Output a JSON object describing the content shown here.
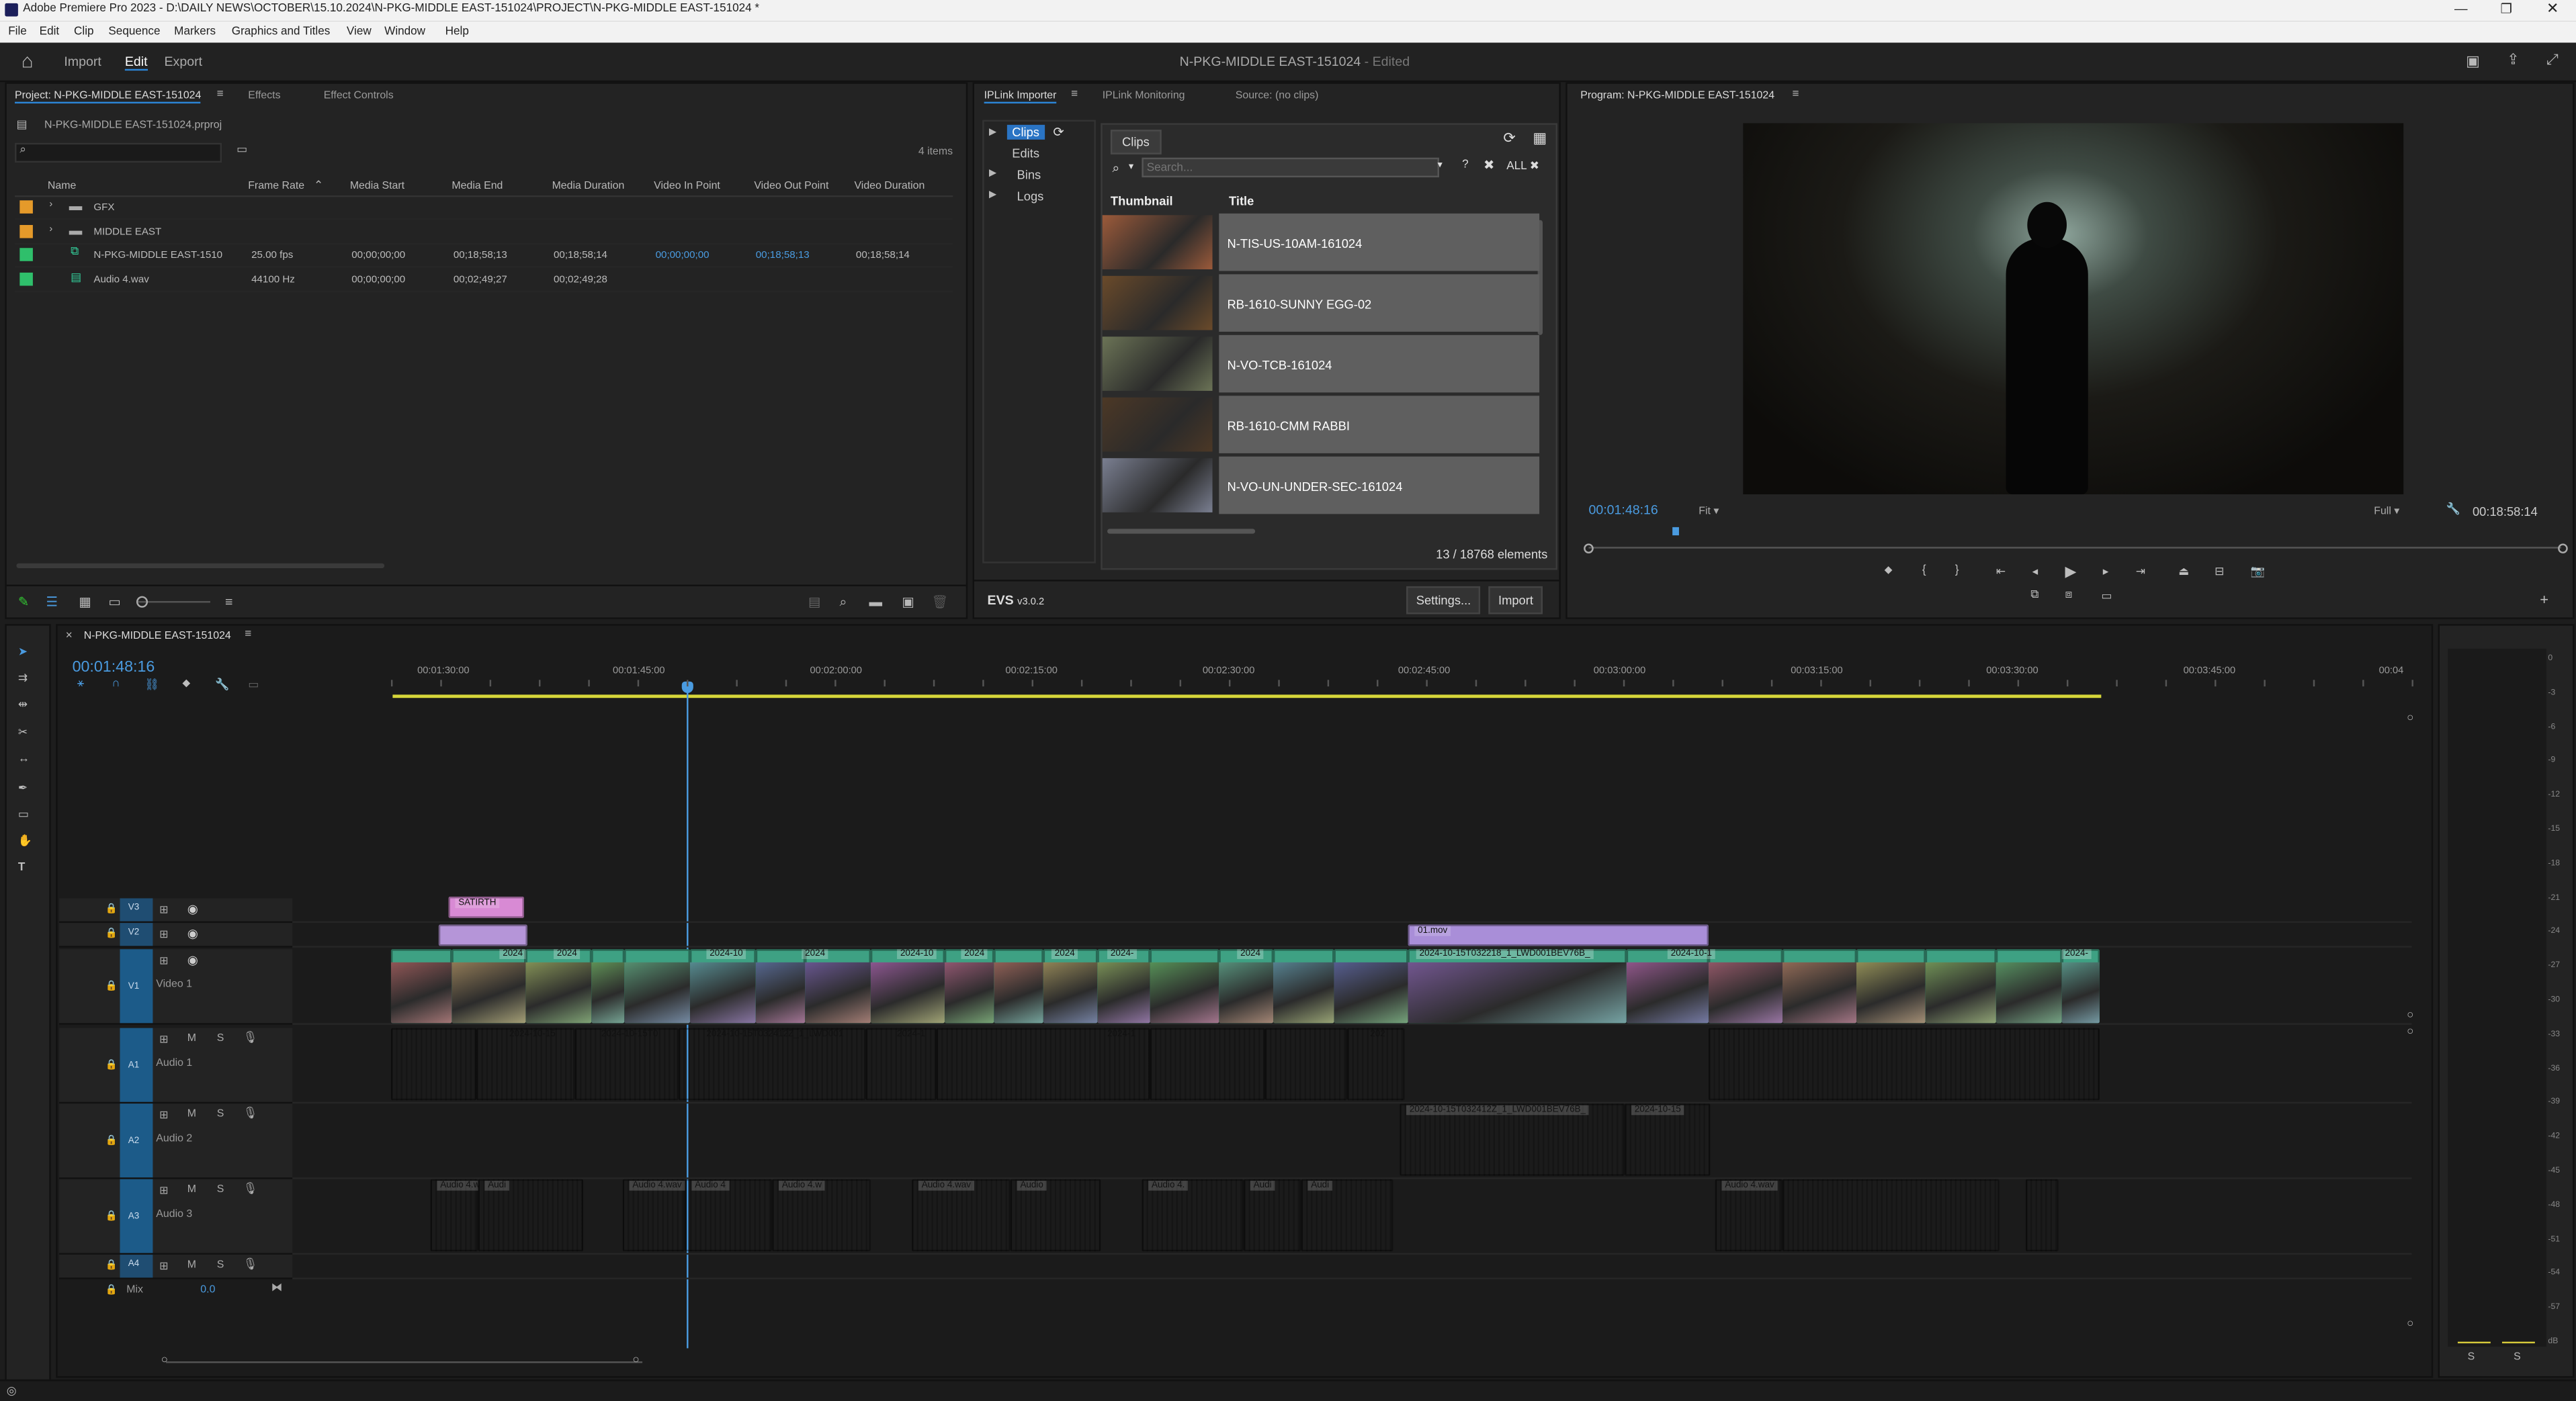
{
  "window": {
    "title": "Adobe Premiere Pro 2023 - D:\\DAILY NEWS\\OCTOBER\\15.10.2024\\N-PKG-MIDDLE EAST-151024\\PROJECT\\N-PKG-MIDDLE EAST-151024 *"
  },
  "menu": [
    "File",
    "Edit",
    "Clip",
    "Sequence",
    "Markers",
    "Graphics and Titles",
    "View",
    "Window",
    "Help"
  ],
  "header": {
    "nav": [
      "Import",
      "Edit",
      "Export"
    ],
    "doc_title": "N-PKG-MIDDLE EAST-151024",
    "doc_status": " - Edited"
  },
  "project_panel": {
    "tabs": [
      "Project: N-PKG-MIDDLE EAST-151024",
      "Effects",
      "Effect Controls"
    ],
    "file": "N-PKG-MIDDLE EAST-151024.prproj",
    "items_count": "4 items",
    "columns": [
      "Name",
      "Frame Rate",
      "Media Start",
      "Media End",
      "Media Duration",
      "Video In Point",
      "Video Out Point",
      "Video Duration"
    ],
    "rows": [
      {
        "name": "GFX",
        "fr": "",
        "ms": "",
        "me": "",
        "md": "",
        "vin": "",
        "vout": "",
        "vd": "",
        "color": "#e59a2a"
      },
      {
        "name": "MIDDLE EAST",
        "fr": "",
        "ms": "",
        "me": "",
        "md": "",
        "vin": "",
        "vout": "",
        "vd": "",
        "color": "#e59a2a"
      },
      {
        "name": "N-PKG-MIDDLE EAST-1510",
        "fr": "25.00 fps",
        "ms": "00;00;00;00",
        "me": "00;18;58;13",
        "md": "00;18;58;14",
        "vin": "00;00;00;00",
        "vout": "00;18;58;13",
        "vd": "00;18;58;14",
        "color": "#2fbf6b"
      },
      {
        "name": "Audio 4.wav",
        "fr": "44100 Hz",
        "ms": "00;00;00;00",
        "me": "00;02;49;27",
        "md": "00;02;49;28",
        "vin": "",
        "vout": "",
        "vd": "",
        "color": "#2fbf6b"
      }
    ]
  },
  "iplink": {
    "tabs": [
      "IPLink Importer",
      "IPLink Monitoring",
      "Source: (no clips)"
    ],
    "tree": [
      "Clips",
      "Edits",
      "Bins",
      "Logs"
    ],
    "clips_tab": "Clips",
    "search_placeholder": "Search...",
    "search_help": "?",
    "all_label": "ALL",
    "table_headers": [
      "Thumbnail",
      "Title"
    ],
    "clips": [
      "N-TIS-US-10AM-161024",
      "RB-1610-SUNNY EGG-02",
      "N-VO-TCB-161024",
      "RB-1610-CMM RABBI",
      "N-VO-UN-UNDER-SEC-161024"
    ],
    "count": "13 / 18768 elements",
    "version": "v3.0.2",
    "brand": "EVS",
    "settings": "Settings...",
    "import": "Import"
  },
  "program": {
    "title": "Program: N-PKG-MIDDLE EAST-151024",
    "timecode": "00:01:48:16",
    "fit": "Fit",
    "full": "Full",
    "duration": "00:18:58:14"
  },
  "timeline": {
    "seq_name": "N-PKG-MIDDLE EAST-151024",
    "timecode": "00:01:48:16",
    "ruler": [
      "00:01:30:00",
      "00:01:45:00",
      "00:02:00:00",
      "00:02:15:00",
      "00:02:30:00",
      "00:02:45:00",
      "00:03:00:00",
      "00:03:15:00",
      "00:03:30:00",
      "00:03:45:00",
      "00:04"
    ],
    "tracks_video": [
      {
        "id": "V3",
        "name": ""
      },
      {
        "id": "V2",
        "name": ""
      },
      {
        "id": "V1",
        "name": "Video 1"
      }
    ],
    "tracks_audio": [
      {
        "id": "A1",
        "name": "Audio 1"
      },
      {
        "id": "A2",
        "name": "Audio 2"
      },
      {
        "id": "A3",
        "name": "Audio 3"
      },
      {
        "id": "A4",
        "name": ""
      }
    ],
    "mix_label": "Mix",
    "mix_value": "0.0",
    "v3_clip": "SATIRTH",
    "v2_clip": "01.mov",
    "v1_labels": [
      "2024",
      "2024",
      "2024-10",
      "2024",
      "2024-10",
      "2024",
      "2024",
      "2024-",
      "2024",
      "2024-10-15T032218_1_LWD001BEV76B_",
      "2024-10-1",
      "2024-"
    ],
    "a1_labels": [
      "2024-10-15",
      "2024-10-15T0",
      "2024-10-15T032412Z_1_LWD001",
      "2024-1",
      "2024-1",
      "202"
    ],
    "a2_labels": [
      "2024-10-15T032412Z_1_LWD001BEV76B_",
      "2024-10-15"
    ],
    "a3_labels": [
      "Audio 4.w",
      "Audi",
      "Audio 4.wav",
      "Audio 4",
      "Audio 4.w",
      "Audio 4.wav",
      "Audio",
      "Audio 4.",
      "Audi",
      "Audi",
      "Audio 4.wav"
    ],
    "meter_labels": [
      "0",
      "-3",
      "-6",
      "-9",
      "-12",
      "-15",
      "-18",
      "-21",
      "-24",
      "-27",
      "-30",
      "-33",
      "-36",
      "-39",
      "-42",
      "-45",
      "-48",
      "-51",
      "-54",
      "-57",
      "dB"
    ],
    "meter_solo": [
      "S",
      "S"
    ]
  }
}
